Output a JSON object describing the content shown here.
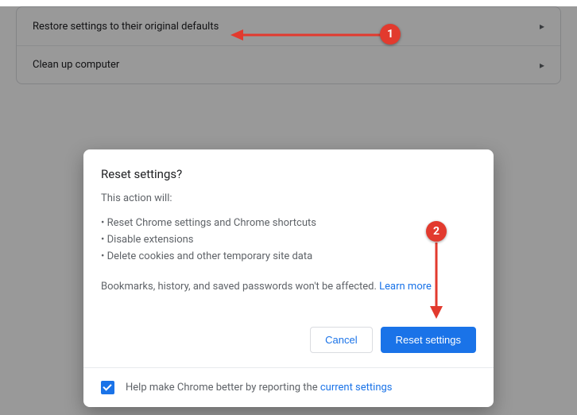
{
  "settings": {
    "rows": [
      {
        "label": "Restore settings to their original defaults"
      },
      {
        "label": "Clean up computer"
      }
    ]
  },
  "dialog": {
    "title": "Reset settings?",
    "lead": "This action will:",
    "bullets": [
      "Reset Chrome settings and Chrome shortcuts",
      "Disable extensions",
      "Delete cookies and other temporary site data"
    ],
    "note_prefix": "Bookmarks, history, and saved passwords won't be affected. ",
    "learn_more": "Learn more",
    "cancel": "Cancel",
    "confirm": "Reset settings",
    "help_prefix": "Help make Chrome better by reporting the ",
    "help_link": "current settings",
    "help_checked": true
  },
  "annotations": {
    "one": "1",
    "two": "2"
  }
}
